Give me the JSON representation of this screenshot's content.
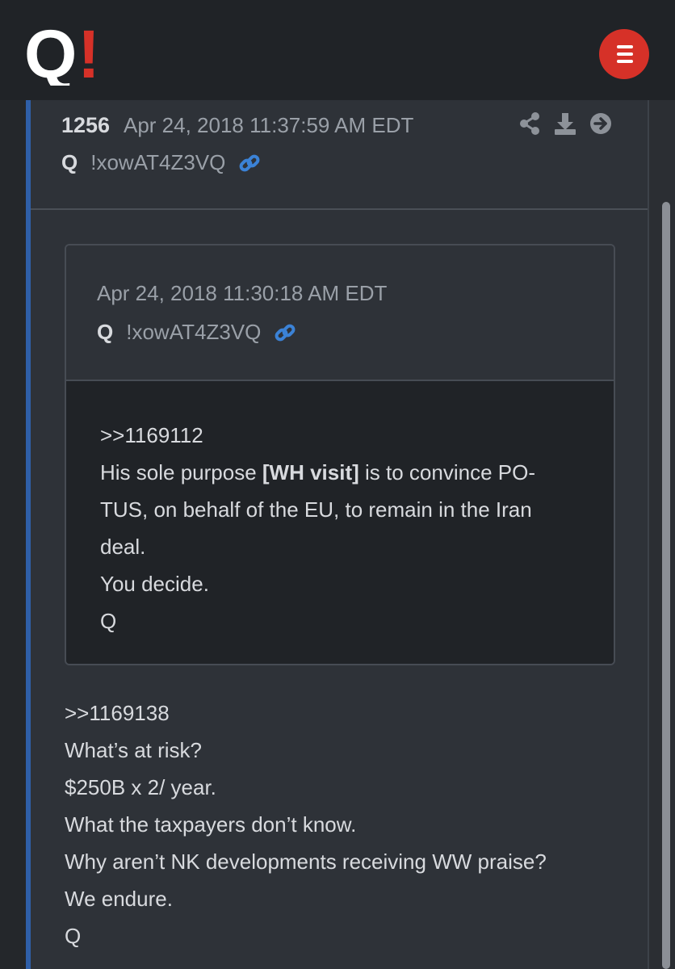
{
  "header": {
    "logo_letter": "Q",
    "logo_mark": "!",
    "menu_icon": "hamburger-icon",
    "colors": {
      "logo_mark": "#d63128",
      "menu_button": "#d63128",
      "accent": "#2f5fa8"
    }
  },
  "post": {
    "number": "1256",
    "date": "Apr 24, 2018 11:37:59 AM EDT",
    "author": "Q",
    "tripcode": "!xowAT4Z3VQ",
    "actions": [
      "share-icon",
      "download-icon",
      "arrow-right-circle-icon"
    ],
    "quoted": {
      "date": "Apr 24, 2018 11:30:18 AM EDT",
      "author": "Q",
      "tripcode": "!xowAT4Z3VQ",
      "lines": {
        "ref": ">>1169112",
        "l1_pre": "His sole purpose ",
        "l1_bold": "[WH visit]",
        "l1_post": " is to convince PO-",
        "l2": "TUS, on behalf of the EU, to remain in the Iran",
        "l3": "deal.",
        "l4": "You decide.",
        "l5": "Q"
      }
    },
    "body": [
      ">>1169138",
      "What’s at risk?",
      "$250B x 2/ year.",
      "What the taxpayers don’t know.",
      "Why aren’t NK developments receiving WW praise?",
      "We endure.",
      "Q"
    ]
  }
}
